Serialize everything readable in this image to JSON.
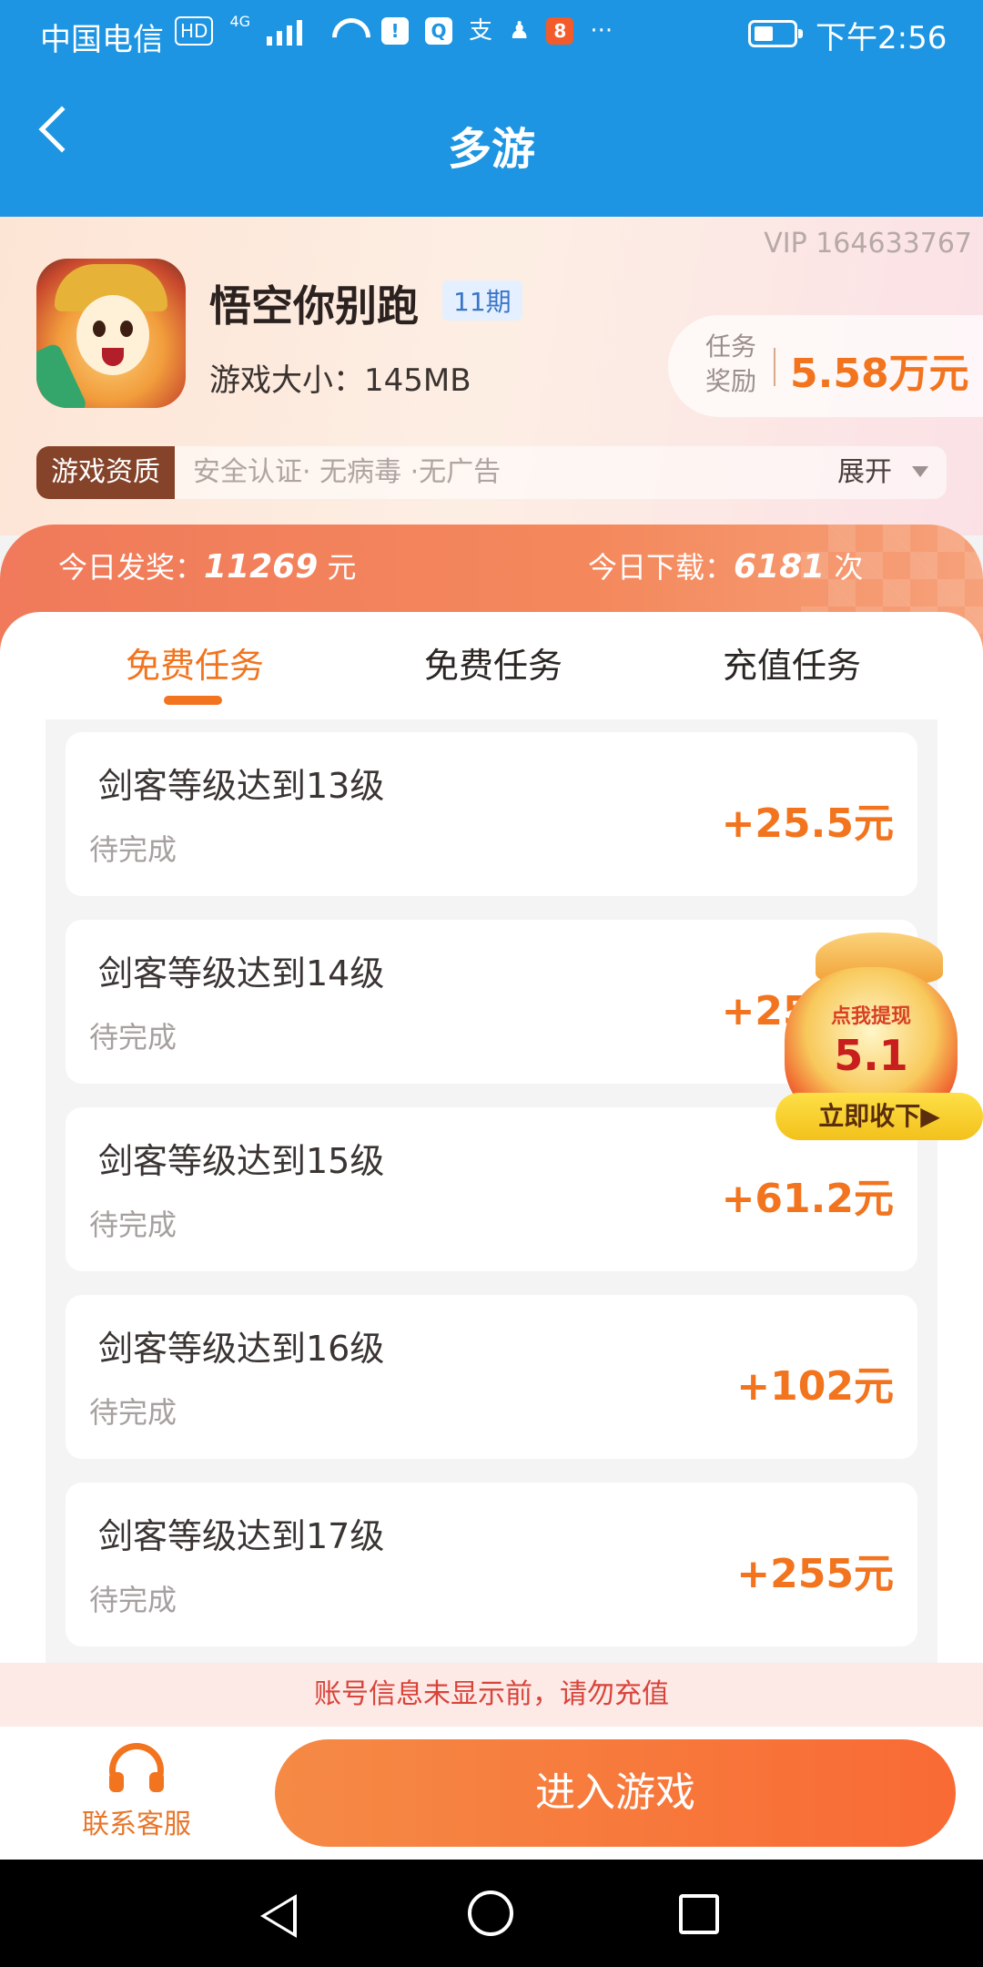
{
  "status_bar": {
    "carrier": "中国电信",
    "hd_badge": "HD",
    "network": "4G",
    "overflow": "···",
    "time": "下午2:56",
    "icons": [
      "hd-icon",
      "signal-icon",
      "wifi-icon",
      "alert-icon",
      "search-app-icon",
      "alipay-icon",
      "qq-icon",
      "app-icon",
      "battery-icon"
    ]
  },
  "header": {
    "title": "多游"
  },
  "game": {
    "vip": "VIP 164633767",
    "name": "悟空你别跑",
    "issue": "11期",
    "size": "游戏大小：145MB",
    "reward_label": "任务奖励",
    "reward_value": "5.58万元",
    "qualification_tag": "游戏资质",
    "qualification_text": "安全认证· 无病毒 ·无广告",
    "expand_label": "展开"
  },
  "stats": {
    "today_reward_label": "今日发奖：",
    "today_reward_value": "11269",
    "today_reward_unit": "元",
    "today_download_label": "今日下载：",
    "today_download_value": "6181",
    "today_download_unit": "次"
  },
  "tabs": [
    {
      "label": "免费任务"
    },
    {
      "label": "免费任务"
    },
    {
      "label": "充值任务"
    }
  ],
  "tasks": [
    {
      "title": "剑客等级达到13级",
      "status": "待完成",
      "reward": "+25.5元"
    },
    {
      "title": "剑客等级达到14级",
      "status": "待完成",
      "reward": "+25.5元"
    },
    {
      "title": "剑客等级达到15级",
      "status": "待完成",
      "reward": "+61.2元"
    },
    {
      "title": "剑客等级达到16级",
      "status": "待完成",
      "reward": "+102元"
    },
    {
      "title": "剑客等级达到17级",
      "status": "待完成",
      "reward": "+255元"
    }
  ],
  "bag": {
    "label": "点我提现",
    "amount": "5.1",
    "button": "立即收下▶"
  },
  "warning": "账号信息未显示前，请勿充值",
  "bottom": {
    "service_label": "联系客服",
    "enter_label": "进入游戏"
  },
  "colors": {
    "header": "#1d95e2",
    "accent": "#f2741e",
    "warning": "#d8443a"
  }
}
